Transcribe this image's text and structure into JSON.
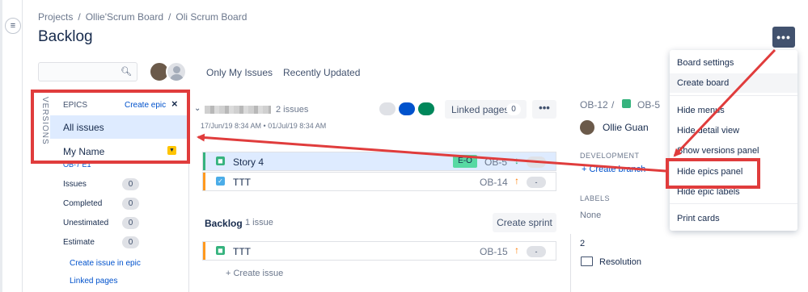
{
  "breadcrumb": [
    "Projects",
    "Ollie'Scrum Board",
    "Oli Scrum Board"
  ],
  "page_title": "Backlog",
  "nav_toggle_icon": "hamburger-icon",
  "filters": {
    "only_my_issues": "Only My Issues",
    "recently_updated": "Recently Updated"
  },
  "epics_panel": {
    "versions_tab": "VERSIONS",
    "title": "EPICS",
    "create_epic": "Create epic",
    "close": "×",
    "all_issues": "All issues",
    "epic_name": "My Name",
    "epic_key": "OB-7 E1",
    "stats": [
      {
        "label": "Issues",
        "value": "0"
      },
      {
        "label": "Completed",
        "value": "0"
      },
      {
        "label": "Unestimated",
        "value": "0"
      },
      {
        "label": "Estimate",
        "value": "0"
      }
    ],
    "links": [
      "Create issue in epic",
      "Linked pages"
    ]
  },
  "sprint": {
    "count": "2 issues",
    "dates": "17/Jun/19 8:34 AM • 01/Jul/19 8:34 AM",
    "linked_pages": "Linked pages",
    "linked_pages_count": "0",
    "more": "•••",
    "status_colors": [
      "#dfe1e6",
      "#0052cc",
      "#00875a"
    ]
  },
  "sprint_issues": [
    {
      "summary": "Story 4",
      "key": "OB-5",
      "epic": "E-O",
      "priority": "↓",
      "priority_color": "#36b37e",
      "estimate": "-",
      "type": "story",
      "selected": true
    },
    {
      "summary": "TTT",
      "key": "OB-14",
      "priority": "↑",
      "priority_color": "#ff7a00",
      "estimate": "-",
      "type": "task",
      "selected": false
    }
  ],
  "backlog": {
    "title": "Backlog",
    "count": "1 issue",
    "create_sprint": "Create sprint",
    "create_issue": "+ Create issue",
    "issues": [
      {
        "summary": "TTT",
        "key": "OB-15",
        "priority": "↑",
        "priority_color": "#ff7a00",
        "estimate": "-",
        "type": "story"
      }
    ]
  },
  "detail": {
    "parent_key": "OB-12",
    "sep": "/",
    "key": "OB-5",
    "assignee": "Ollie Guan",
    "development_label": "DEVELOPMENT",
    "create_branch": "+ Create branch",
    "labels_label": "LABELS",
    "labels_value": "None",
    "number": "2",
    "resolution": "Resolution"
  },
  "menu": {
    "more_button": "•••",
    "items": [
      "Board settings",
      "Create board",
      "Hide menus",
      "Hide detail view",
      "Show versions panel",
      "Hide epics panel",
      "Hide epic labels",
      "Print cards"
    ]
  },
  "annotation_color": "#e03c3c"
}
